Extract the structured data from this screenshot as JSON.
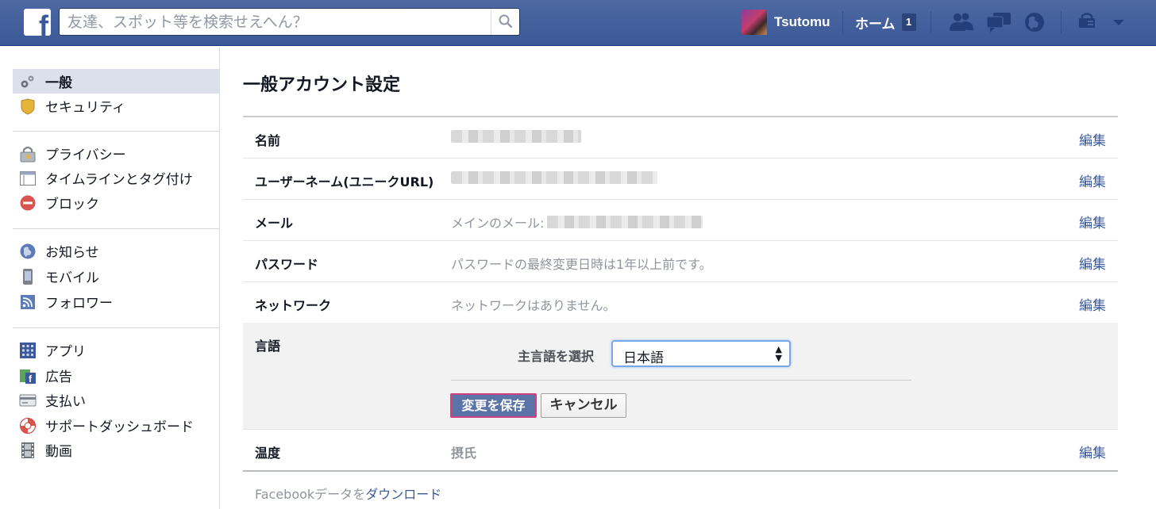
{
  "topbar": {
    "search_placeholder": "友達、スポット等を検索せえへん？",
    "user_name": "Tsutomu",
    "home_label": "ホーム",
    "home_badge": "1"
  },
  "leftnav": {
    "group1": [
      {
        "label": "一般",
        "icon": "gears-icon",
        "active": true
      },
      {
        "label": "セキュリティ",
        "icon": "shield-icon"
      }
    ],
    "group2": [
      {
        "label": "プライバシー",
        "icon": "lock-icon"
      },
      {
        "label": "タイムラインとタグ付け",
        "icon": "timeline-icon"
      },
      {
        "label": "ブロック",
        "icon": "block-icon"
      }
    ],
    "group3": [
      {
        "label": "お知らせ",
        "icon": "globe-icon"
      },
      {
        "label": "モバイル",
        "icon": "mobile-icon"
      },
      {
        "label": "フォロワー",
        "icon": "rss-icon"
      }
    ],
    "group4": [
      {
        "label": "アプリ",
        "icon": "apps-icon"
      },
      {
        "label": "広告",
        "icon": "ads-icon"
      },
      {
        "label": "支払い",
        "icon": "payment-card-icon"
      },
      {
        "label": "サポートダッシュボード",
        "icon": "lifebuoy-icon"
      },
      {
        "label": "動画",
        "icon": "film-icon"
      }
    ]
  },
  "main": {
    "title": "一般アカウント設定",
    "edit_label": "編集",
    "rows": {
      "name": {
        "label": "名前"
      },
      "username": {
        "label": "ユーザーネーム(ユニークURL)"
      },
      "email": {
        "label": "メール",
        "prefix": "メインのメール:"
      },
      "password": {
        "label": "パスワード",
        "value": "パスワードの最終変更日時は1年以上前です。"
      },
      "network": {
        "label": "ネットワーク",
        "value": "ネットワークはありません。"
      },
      "language": {
        "label": "言語",
        "select_label": "主言語を選択",
        "selected": "日本語",
        "save_label": "変更を保存",
        "cancel_label": "キャンセル"
      },
      "temperature": {
        "label": "温度",
        "value": "摂氏"
      }
    },
    "download_prefix": "Facebookデータを",
    "download_link": "ダウンロード"
  },
  "colors": {
    "brand_blue": "#3b5998",
    "save_button": "#5b74a8",
    "focus_outline": "#d23f7f"
  }
}
